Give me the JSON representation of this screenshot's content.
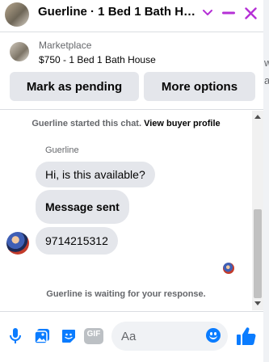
{
  "header": {
    "title": "Guerline · 1 Bed 1 Bath House",
    "title_display": "Guerline · 1 Bed 1 Bath Ho...",
    "icons": [
      "chevron-down-icon",
      "minimize-icon",
      "close-icon"
    ]
  },
  "listing": {
    "label": "Marketplace",
    "title": "$750 - 1 Bed 1 Bath House"
  },
  "actions": {
    "mark_pending": "Mark as pending",
    "more_options": "More options"
  },
  "conversation": {
    "started_text": "Guerline started this chat.",
    "profile_link": "View buyer profile",
    "sender_name": "Guerline",
    "messages": [
      {
        "text": "Hi, is this available?",
        "bold": false
      },
      {
        "text": "Message sent",
        "bold": true
      },
      {
        "text": "9714215312",
        "bold": false
      }
    ],
    "waiting_text": "Guerline is waiting for your response."
  },
  "composer": {
    "placeholder": "Aa",
    "gif_label": "GIF",
    "icons": [
      "microphone-icon",
      "photo-icon",
      "sticker-icon",
      "gif-icon",
      "emoji-icon",
      "thumbs-up-icon"
    ]
  },
  "side_strip": {
    "text_1": "w",
    "text_2": "a"
  },
  "colors": {
    "accent": "#0a7cff",
    "header_controls": "#b530d6",
    "bubble": "#e4e6eb",
    "secondary_text": "#65676b"
  }
}
